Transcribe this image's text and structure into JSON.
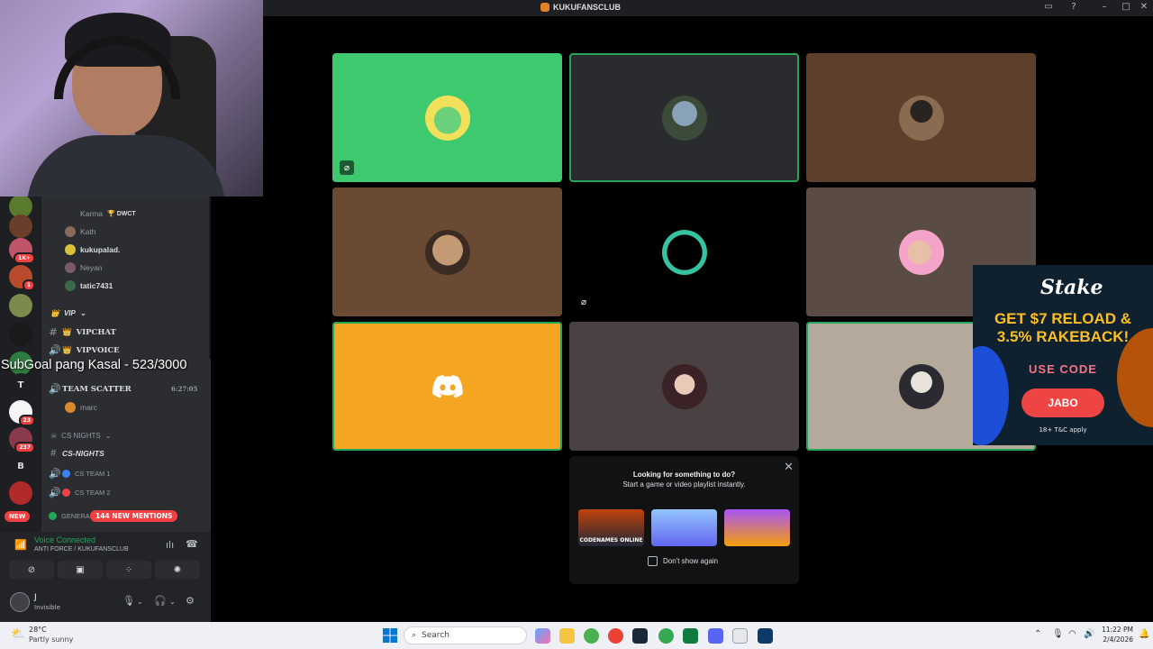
{
  "window": {
    "title": "KUKUFANSCLUB"
  },
  "overlay": {
    "subgoal": "SubGoal pang Kasal - 523/3000"
  },
  "channels": {
    "members_top": [
      {
        "name": "Karma",
        "tag": "DWCT"
      },
      {
        "name": "Kath"
      },
      {
        "name": "kukupalad."
      },
      {
        "name": "Neyan"
      },
      {
        "name": "tatic7431"
      }
    ],
    "vip_category": "VIP",
    "vipchat": "VIPCHAT",
    "vipvoice": "VIPVOICE",
    "team_scatter": "TEAM SCATTER",
    "team_scatter_time": "6:27:05",
    "marc": "marc",
    "cs_nights_category": "CS NIGHTS",
    "cs_nights_channel": "CS-NIGHTS",
    "cs_team_1": "CS TEAM 1",
    "cs_team_2": "CS TEAM 2",
    "general": "GENERA",
    "new_badge": "NEW",
    "mentions": "144 NEW MENTIONS"
  },
  "guilds": [
    {
      "label": "",
      "badge": ""
    },
    {
      "label": "",
      "badge": "1K+"
    },
    {
      "label": "",
      "badge": "1"
    },
    {
      "label": "",
      "badge": ""
    },
    {
      "label": "",
      "badge": ""
    },
    {
      "label": "T",
      "badge": ""
    },
    {
      "label": "",
      "badge": "23"
    },
    {
      "label": "",
      "badge": "237"
    },
    {
      "label": "B",
      "badge": ""
    }
  ],
  "voice": {
    "status": "Voice Connected",
    "location": "ANTI FORCE / KUKUFANSCLUB",
    "user_name": "J",
    "user_status": "Invisible"
  },
  "activity": {
    "headline": "Looking for something to do?",
    "subline": "Start a game or video playlist instantly.",
    "games": [
      "CODENAMES ONLINE",
      "",
      ""
    ],
    "dont_show": "Don't show again"
  },
  "ad": {
    "brand": "Stake",
    "promo_line1": "GET $7 RELOAD &",
    "promo_line2": "3.5% RAKEBACK!",
    "use_code": "USE CODE",
    "code": "JABO",
    "terms": "18+ T&C apply"
  },
  "taskbar": {
    "temp": "28°C",
    "weather": "Partly sunny",
    "search": "Search",
    "time": "11:22 PM",
    "date": "2/4/2026"
  },
  "colors": {
    "tile_green": "#3ec96f",
    "tile_dark": "#2a2b2e",
    "tile_brown": "#5e3f2b",
    "tile_orange": "#f4a622",
    "tile_gray": "#4a4143",
    "tile_beige": "#b5a99c",
    "speaking": "#23a55a",
    "ad_yellow": "#fbbf24"
  }
}
